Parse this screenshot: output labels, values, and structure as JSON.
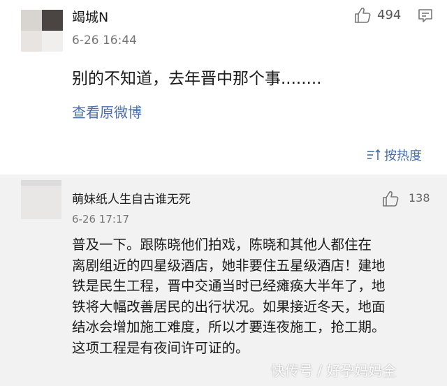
{
  "comment": {
    "username": "竭城N",
    "timestamp": "6-26 16:44",
    "like_count": "494",
    "text": "别的不知道，去年晋中那个事........",
    "view_original_link": "查看原微博"
  },
  "sort": {
    "label": "按热度"
  },
  "reply": {
    "username": "萌妹纸人生自古谁无死",
    "timestamp": "6-26 17:17",
    "like_count": "138",
    "lines": [
      "普及一下。跟陈晓他们拍戏，陈晓和其他人都住在",
      "离剧组近的四星级酒店，她非要住五星级酒店！建地",
      "铁是民生工程，晋中交通当时已经瘫痪大半年了，地",
      "铁将大幅改善居民的出行状况。如果接近冬天，地面",
      "结冰会增加施工难度，所以才要连夜施工，抢工期。",
      "这项工程是有夜间许可证的。"
    ]
  },
  "watermark": "快传号 / 好孕妈妈全",
  "colors": {
    "link": "#4b6ea8",
    "reply_background": "#f2f2f2",
    "icon": "#777777"
  },
  "icons": [
    "thumbs-up-icon",
    "comment-icon",
    "sort-icon"
  ]
}
